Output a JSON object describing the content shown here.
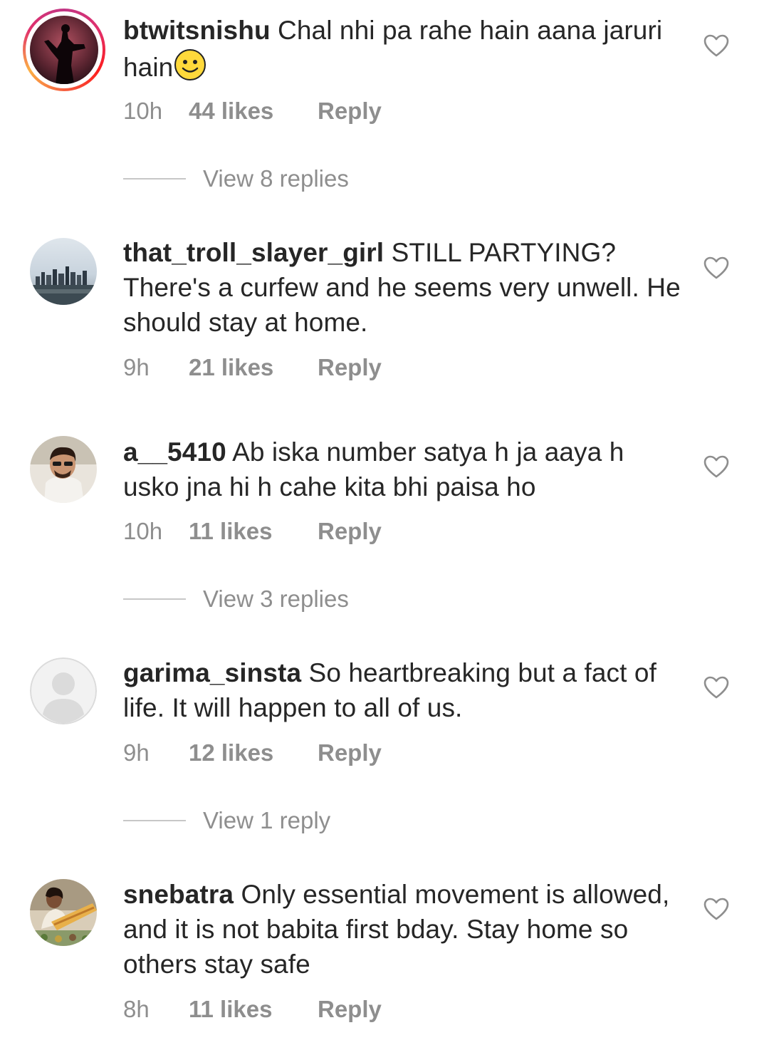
{
  "comments": [
    {
      "username": "btwitsnishu",
      "text": "Chal nhi pa rahe hain aana jaruri hain",
      "time": "10h",
      "likes": "44 likes",
      "reply": "Reply",
      "view_replies": "View 8 replies",
      "has_story": true,
      "emoji": "slightly-smiling-face"
    },
    {
      "username": "that_troll_slayer_girl",
      "text": "STILL PARTYING? There's a curfew and he seems very unwell. He should stay at home.",
      "time": "9h",
      "likes": "21 likes",
      "reply": "Reply"
    },
    {
      "username": "a__5410",
      "text": "Ab iska number satya h ja aaya h usko jna hi h cahe kita bhi paisa ho",
      "time": "10h",
      "likes": "11 likes",
      "reply": "Reply",
      "view_replies": "View 3 replies"
    },
    {
      "username": "garima_sinsta",
      "text": "So heartbreaking but a fact of life. It will happen to all of us.",
      "time": "9h",
      "likes": "12 likes",
      "reply": "Reply",
      "view_replies": "View 1 reply"
    },
    {
      "username": "snebatra",
      "text": "Only essential movement is allowed, and it is not babita first bday. Stay home so others stay safe",
      "time": "8h",
      "likes": "11 likes",
      "reply": "Reply"
    }
  ],
  "icons": {
    "like": "heart-outline-icon",
    "emoji": "smiling-face-emoji"
  },
  "colors": {
    "text": "#262626",
    "secondary": "#8e8e8e",
    "divider": "#c7c7c7"
  }
}
